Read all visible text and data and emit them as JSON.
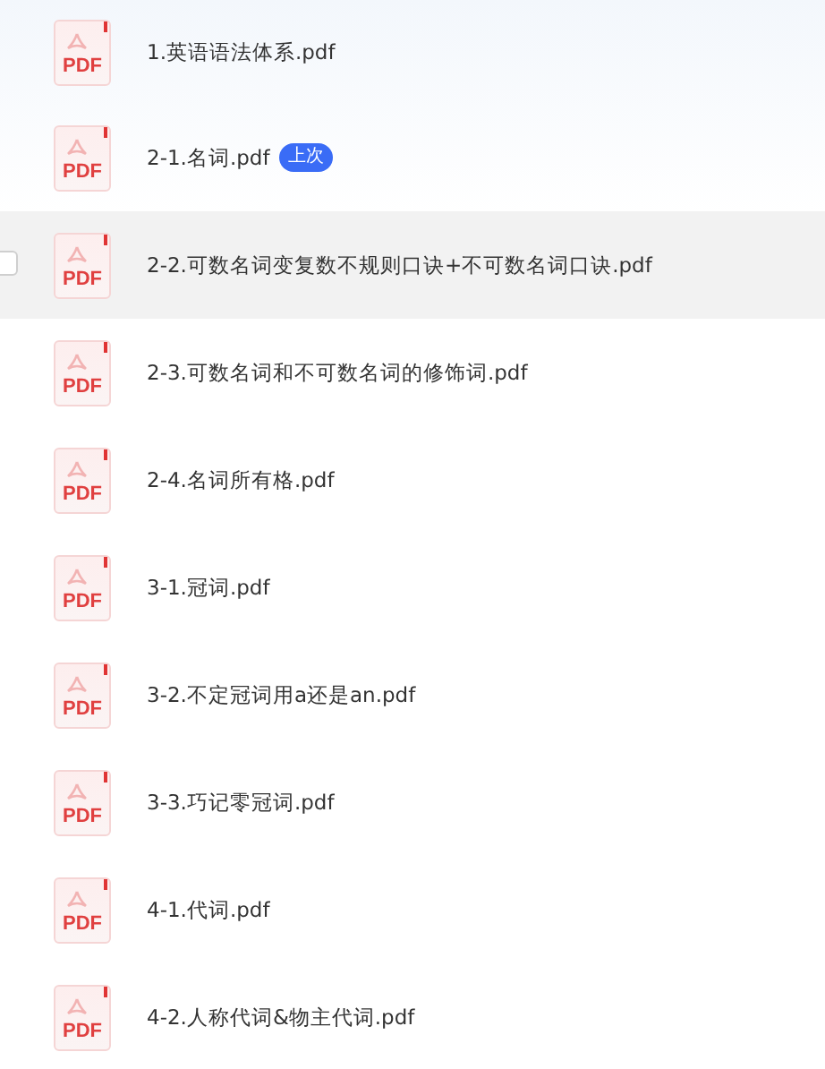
{
  "files": [
    {
      "name": "1.英语语法体系.pdf",
      "icon_label": "PDF",
      "hovered": false,
      "checked": false
    },
    {
      "name": "2-1.名词.pdf",
      "icon_label": "PDF",
      "badge": "上次",
      "hovered": false,
      "checked": false
    },
    {
      "name": "2-2.可数名词变复数不规则口诀+不可数名词口诀.pdf",
      "icon_label": "PDF",
      "hovered": true,
      "checked": false
    },
    {
      "name": "2-3.可数名词和不可数名词的修饰词.pdf",
      "icon_label": "PDF",
      "hovered": false,
      "checked": false
    },
    {
      "name": "2-4.名词所有格.pdf",
      "icon_label": "PDF",
      "hovered": false,
      "checked": false
    },
    {
      "name": "3-1.冠词.pdf",
      "icon_label": "PDF",
      "hovered": false,
      "checked": false
    },
    {
      "name": "3-2.不定冠词用a还是an.pdf",
      "icon_label": "PDF",
      "hovered": false,
      "checked": false
    },
    {
      "name": "3-3.巧记零冠词.pdf",
      "icon_label": "PDF",
      "hovered": false,
      "checked": false
    },
    {
      "name": "4-1.代词.pdf",
      "icon_label": "PDF",
      "hovered": false,
      "checked": false
    },
    {
      "name": "4-2.人称代词&物主代词.pdf",
      "icon_label": "PDF",
      "hovered": false,
      "checked": false
    }
  ]
}
